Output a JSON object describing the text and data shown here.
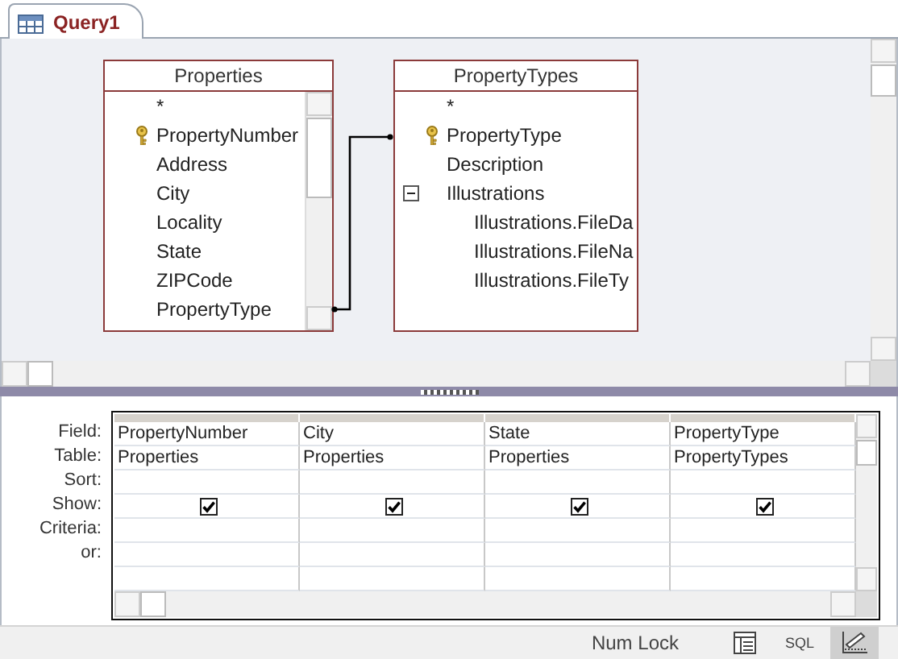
{
  "tab": {
    "label": "Query1",
    "selected": true
  },
  "field_lists": [
    {
      "title": "Properties",
      "fields": [
        {
          "label": "*",
          "key": false
        },
        {
          "label": "PropertyNumber",
          "key": true
        },
        {
          "label": "Address",
          "key": false
        },
        {
          "label": "City",
          "key": false
        },
        {
          "label": "Locality",
          "key": false
        },
        {
          "label": "State",
          "key": false
        },
        {
          "label": "ZIPCode",
          "key": false
        },
        {
          "label": "PropertyType",
          "key": false
        }
      ]
    },
    {
      "title": "PropertyTypes",
      "fields": [
        {
          "label": "*",
          "key": false
        },
        {
          "label": "PropertyType",
          "key": true
        },
        {
          "label": "Description",
          "key": false
        },
        {
          "label": "Illustrations",
          "key": false,
          "expanded": true,
          "children": [
            {
              "label": "Illustrations.FileDa",
              "key": false
            },
            {
              "label": "Illustrations.FileNa",
              "key": false
            },
            {
              "label": "Illustrations.FileTy",
              "key": false
            }
          ]
        }
      ]
    }
  ],
  "grid": {
    "row_labels": [
      "Field:",
      "Table:",
      "Sort:",
      "Show:",
      "Criteria:",
      "or:"
    ],
    "columns": [
      {
        "field": "PropertyNumber",
        "table": "Properties",
        "show": true
      },
      {
        "field": "City",
        "table": "Properties",
        "show": true
      },
      {
        "field": "State",
        "table": "Properties",
        "show": true
      },
      {
        "field": "PropertyType",
        "table": "PropertyTypes",
        "show": true
      }
    ]
  },
  "status_bar": {
    "indicator": "Num Lock",
    "views": [
      {
        "kind": "datasheet",
        "selected": false
      },
      {
        "kind": "sql",
        "label": "SQL",
        "selected": false
      },
      {
        "kind": "design",
        "selected": true
      }
    ]
  }
}
